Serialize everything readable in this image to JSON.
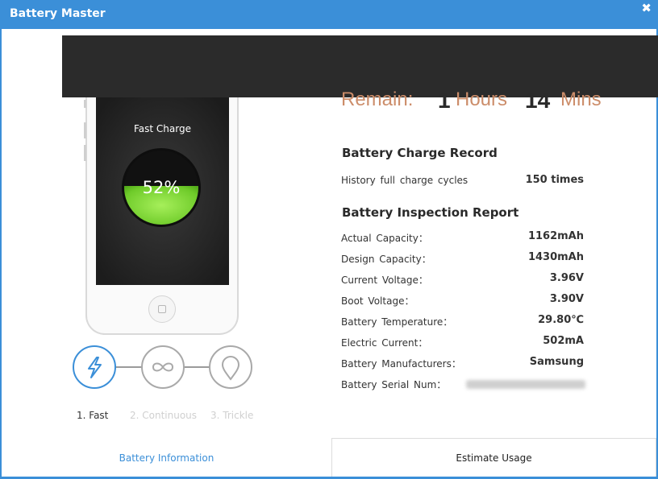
{
  "window": {
    "title": "Battery Master",
    "close_glyph": "✖"
  },
  "phone": {
    "mode_label": "Fast Charge",
    "battery_percent_text": "52%",
    "battery_level": 0.52
  },
  "steps": [
    {
      "label": "1. Fast",
      "icon": "lightning-icon",
      "active": true
    },
    {
      "label": "2. Continuous",
      "icon": "infinity-icon",
      "active": false
    },
    {
      "label": "3. Trickle",
      "icon": "drop-icon",
      "active": false
    }
  ],
  "remain": {
    "label": "Remain:",
    "hours": "1",
    "hours_unit": "Hours",
    "mins": "14",
    "mins_unit": "Mins"
  },
  "charge_record": {
    "title": "Battery Charge Record",
    "rows": [
      {
        "label": "History full charge cycles",
        "value": "150 times"
      }
    ]
  },
  "inspection": {
    "title": "Battery Inspection Report",
    "rows": [
      {
        "label": "Actual Capacity：",
        "value": "1162mAh"
      },
      {
        "label": "Design Capacity：",
        "value": "1430mAh"
      },
      {
        "label": "Current Voltage：",
        "value": "3.96V"
      },
      {
        "label": "Boot Voltage：",
        "value": "3.90V"
      },
      {
        "label": "Battery Temperature：",
        "value": "29.80℃"
      },
      {
        "label": "Electric Current：",
        "value": "502mA"
      },
      {
        "label": "Battery Manufacturers：",
        "value": "Samsung"
      },
      {
        "label": "Battery Serial Num：",
        "value": ""
      }
    ]
  },
  "tabs": {
    "info": "Battery Information",
    "estimate": "Estimate Usage"
  },
  "colors": {
    "accent": "#3b8fd8",
    "remain": "#cc8d6a",
    "battery_green": "#6fcb2a"
  }
}
